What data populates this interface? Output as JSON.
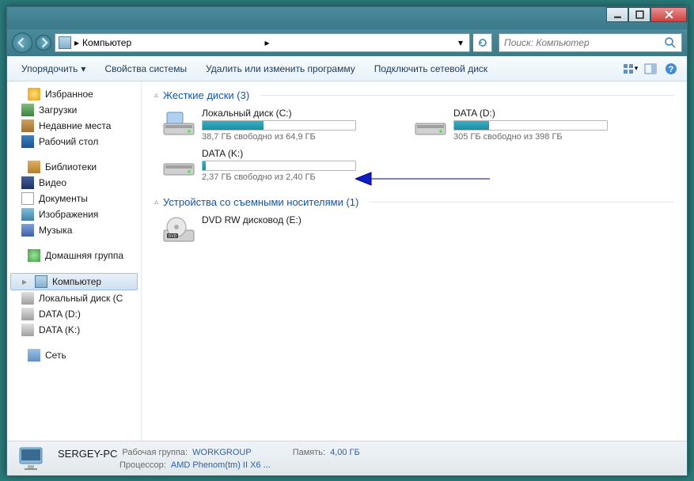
{
  "window": {
    "breadcrumb": "Компьютер",
    "breadcrumb_sep": "▸",
    "search_placeholder": "Поиск: Компьютер"
  },
  "toolbar": {
    "organize": "Упорядочить",
    "properties": "Свойства системы",
    "uninstall": "Удалить или изменить программу",
    "mapdrive": "Подключить сетевой диск"
  },
  "sidebar": {
    "favorites": "Избранное",
    "downloads": "Загрузки",
    "recent": "Недавние места",
    "desktop": "Рабочий стол",
    "libraries": "Библиотеки",
    "videos": "Видео",
    "documents": "Документы",
    "pictures": "Изображения",
    "music": "Музыка",
    "homegroup": "Домашняя группа",
    "computer": "Компьютер",
    "drive_c": "Локальный диск (C",
    "drive_d": "DATA (D:)",
    "drive_k": "DATA (K:)",
    "network": "Сеть"
  },
  "groups": {
    "hdd": "Жесткие диски (3)",
    "removable": "Устройства со съемными носителями (1)"
  },
  "drives": [
    {
      "name": "Локальный диск (C:)",
      "free": "38,7 ГБ свободно из 64,9 ГБ",
      "fill_pct": 40
    },
    {
      "name": "DATA (D:)",
      "free": "305 ГБ свободно из 398 ГБ",
      "fill_pct": 23
    },
    {
      "name": "DATA (K:)",
      "free": "2,37 ГБ свободно из 2,40 ГБ",
      "fill_pct": 2
    }
  ],
  "removable": [
    {
      "name": "DVD RW дисковод (E:)"
    }
  ],
  "status": {
    "name": "SERGEY-PC",
    "workgroup_label": "Рабочая группа:",
    "workgroup": "WORKGROUP",
    "mem_label": "Память:",
    "mem": "4,00 ГБ",
    "cpu_label": "Процессор:",
    "cpu": "AMD Phenom(tm) II X6 ..."
  }
}
